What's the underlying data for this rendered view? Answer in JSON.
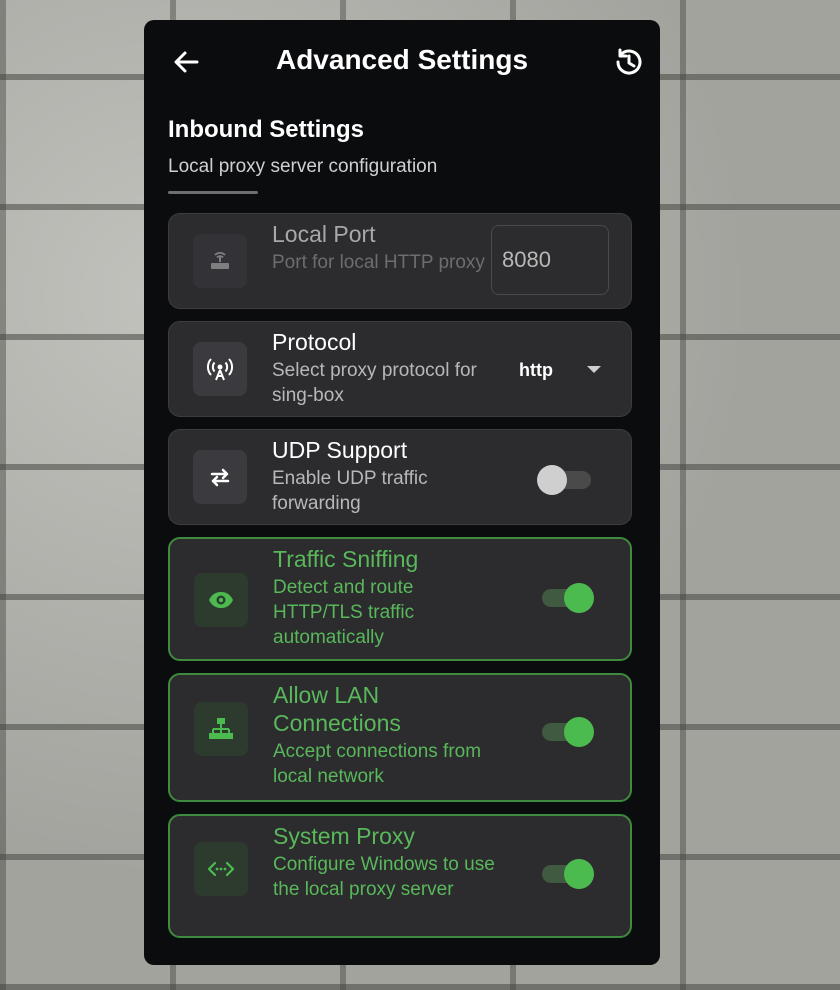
{
  "header": {
    "title": "Advanced Settings"
  },
  "section": {
    "title": "Inbound Settings",
    "subtitle": "Local proxy server configuration"
  },
  "settings": {
    "local_port": {
      "title": "Local Port",
      "subtitle": "Port for local HTTP proxy",
      "value": "8080",
      "icon": "router-icon",
      "enabled": false
    },
    "protocol": {
      "title": "Protocol",
      "subtitle": "Select proxy protocol for sing-box",
      "value": "http",
      "icon": "antenna-icon"
    },
    "udp": {
      "title": "UDP Support",
      "subtitle": "Enable UDP traffic forwarding",
      "on": false,
      "icon": "swap-arrows-icon"
    },
    "sniffing": {
      "title": "Traffic Sniffing",
      "subtitle": "Detect and route HTTP/TLS traffic automatically",
      "on": true,
      "icon": "eye-icon"
    },
    "lan": {
      "title": "Allow LAN Connections",
      "subtitle": "Accept connections from local network",
      "on": true,
      "icon": "network-tree-icon"
    },
    "system_proxy": {
      "title": "System Proxy",
      "subtitle": "Configure Windows to use the local proxy server",
      "on": true,
      "icon": "code-arrows-icon"
    }
  },
  "colors": {
    "accent": "#4cbb4f",
    "panel": "#0b0c0e",
    "card": "#2c2b2e"
  }
}
